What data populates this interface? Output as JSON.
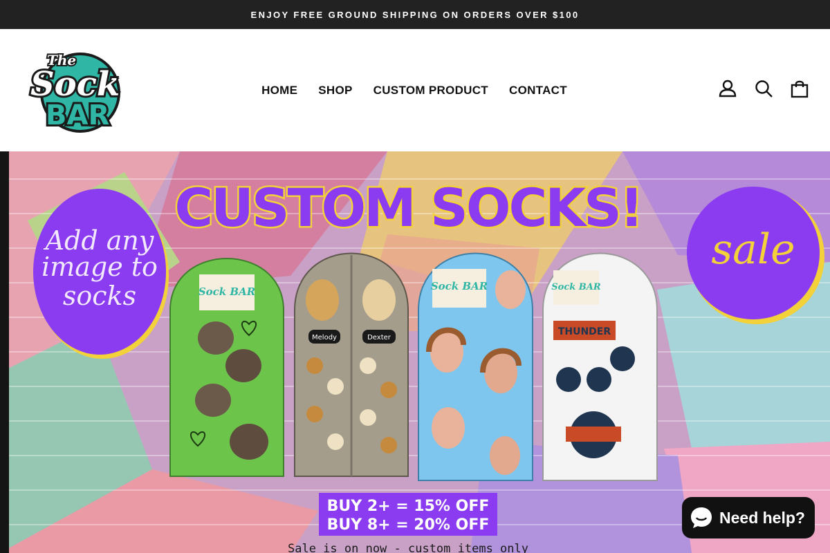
{
  "announcement": {
    "text": "ENJOY FREE GROUND SHIPPING ON ORDERS OVER $100"
  },
  "logo": {
    "line1": "The",
    "line2": "Sock",
    "line3": "BAR",
    "colors": {
      "teal": "#2fb6a4",
      "dark": "#1a1a1a"
    }
  },
  "nav": {
    "items": [
      {
        "label": "HOME"
      },
      {
        "label": "SHOP"
      },
      {
        "label": "CUSTOM PRODUCT"
      },
      {
        "label": "CONTACT"
      }
    ]
  },
  "header_icons": [
    "account-icon",
    "search-icon",
    "cart-icon"
  ],
  "hero": {
    "headline": "CUSTOM SOCKS!",
    "left_badge": {
      "lines": [
        "Add any",
        "image to",
        "socks"
      ]
    },
    "right_badge": {
      "text": "sale"
    },
    "promo": {
      "line1": "BUY 2+ = 15% OFF",
      "line2": "BUY 8+ = 20% OFF"
    },
    "footnote": "Sale is on now - custom items only",
    "socks": [
      {
        "tag": "Sock BAR",
        "theme": "cats",
        "color": "#6dc44a"
      },
      {
        "tag": "",
        "theme": "dogs",
        "names": [
          "Melody",
          "Dexter"
        ],
        "color": "#a59d8c"
      },
      {
        "tag": "Sock BAR",
        "theme": "faces",
        "color": "#7ec6ee"
      },
      {
        "tag": "Sock BAR",
        "theme": "team",
        "text": "THUNDER",
        "color": "#f4f4f4"
      }
    ],
    "colors": {
      "purple": "#8b3cf0",
      "yellow": "#f3d13a"
    }
  },
  "chat": {
    "label": "Need help?"
  }
}
